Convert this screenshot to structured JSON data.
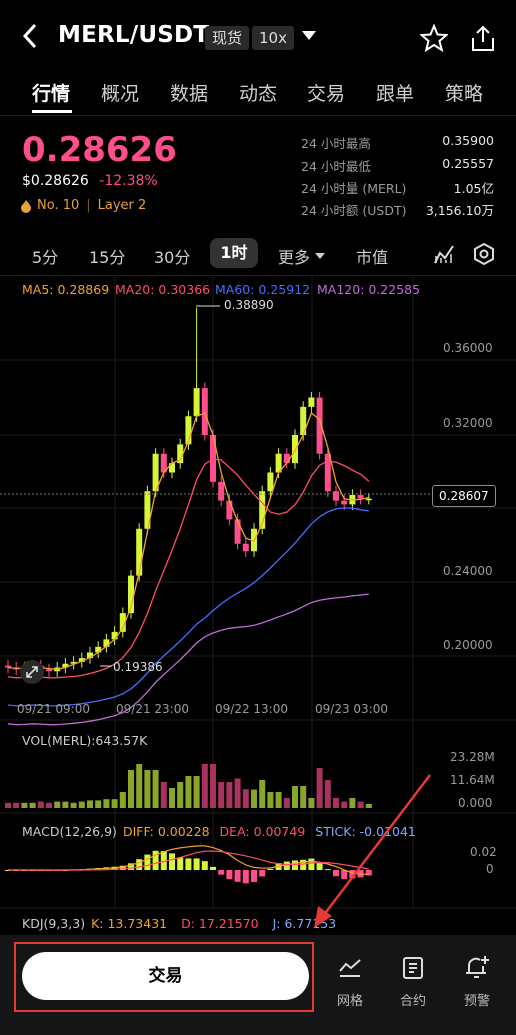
{
  "header": {
    "pair": "MERL/USDT",
    "market_chip": "现货",
    "leverage_chip": "10x"
  },
  "tabs": [
    "行情",
    "概况",
    "数据",
    "动态",
    "交易",
    "跟单",
    "策略"
  ],
  "price": {
    "last": "0.28626",
    "usd": "$0.28626",
    "change": "-12.38%",
    "rank": "No. 10",
    "sector": "Layer 2"
  },
  "stats": [
    {
      "label": "24 小时最高",
      "value": "0.35900"
    },
    {
      "label": "24 小时最低",
      "value": "0.25557"
    },
    {
      "label": "24 小时量 (MERL)",
      "value": "1.05亿"
    },
    {
      "label": "24 小时额 (USDT)",
      "value": "3,156.10万"
    }
  ],
  "timeframes": [
    "5分",
    "15分",
    "30分",
    "1时",
    "更多",
    "市值"
  ],
  "active_timeframe": "1时",
  "ma_legend": {
    "ma5": "MA5: 0.28869",
    "ma20": "MA20: 0.30366",
    "ma60": "MA60: 0.25912",
    "ma120": "MA120: 0.22585"
  },
  "price_axis": [
    "0.36000",
    "0.32000",
    "0.24000",
    "0.20000"
  ],
  "current_price_tag": "0.28607",
  "high_label": "0.38890",
  "low_label": "0.19386",
  "time_axis": [
    "09/21 09:00",
    "09/21 23:00",
    "09/22 13:00",
    "09/23 03:00"
  ],
  "volume": {
    "title": "VOL(MERL):643.57K",
    "axis": [
      "23.28M",
      "11.64M",
      "0.000"
    ]
  },
  "macd": {
    "params": "MACD(12,26,9)",
    "diff": "DIFF: 0.00228",
    "dea": "DEA: 0.00749",
    "stick": "STICK: -0.01041",
    "axis": [
      "0.02",
      "0"
    ]
  },
  "kdj": {
    "params": "KDJ(9,3,3)",
    "k": "K: 13.73431",
    "d": "D: 17.21570",
    "j": "J: 6.77153"
  },
  "bottom": {
    "trade": "交易",
    "grid": "网格",
    "contract": "合约",
    "alert": "预警"
  },
  "colors": {
    "up": "#d6f53a",
    "down": "#ff4e8b",
    "ma5": "#f2a32a",
    "ma20": "#ff4e6a",
    "ma60": "#4c6bff",
    "ma120": "#c36bd8"
  }
}
